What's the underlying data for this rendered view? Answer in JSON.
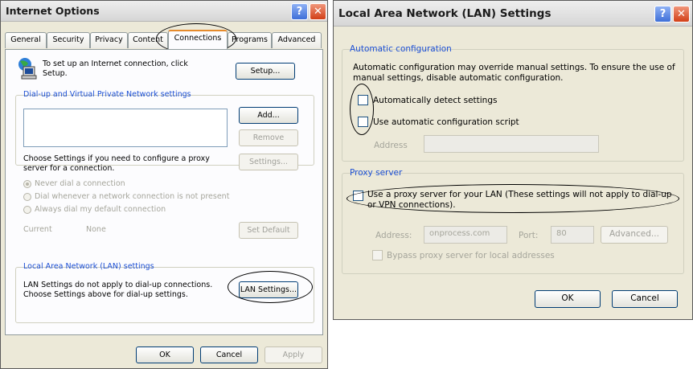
{
  "internet_options": {
    "title": "Internet Options",
    "help_glyph": "?",
    "close_glyph": "✕",
    "tabs": [
      {
        "label": "General"
      },
      {
        "label": "Security"
      },
      {
        "label": "Privacy"
      },
      {
        "label": "Content"
      },
      {
        "label": "Connections"
      },
      {
        "label": "Programs"
      },
      {
        "label": "Advanced"
      }
    ],
    "active_tab": "Connections",
    "setup_text": "To set up an Internet connection, click Setup.",
    "setup_button": "Setup...",
    "dialup_group": "Dial-up and Virtual Private Network settings",
    "add_button": "Add...",
    "remove_button": "Remove",
    "settings_text": "Choose Settings if you need to configure a proxy server for a connection.",
    "settings_button": "Settings...",
    "radio_options": [
      {
        "label": "Never dial a connection",
        "selected": true
      },
      {
        "label": "Dial whenever a network connection is not present",
        "selected": false
      },
      {
        "label": "Always dial my default connection",
        "selected": false
      }
    ],
    "current_label": "Current",
    "current_value": "None",
    "set_default_button": "Set Default",
    "lan_group": "Local Area Network (LAN) settings",
    "lan_text": "LAN Settings do not apply to dial-up connections. Choose Settings above for dial-up settings.",
    "lan_settings_button": "LAN Settings...",
    "ok_button": "OK",
    "cancel_button": "Cancel",
    "apply_button": "Apply"
  },
  "lan_settings": {
    "title": "Local Area Network (LAN) Settings",
    "help_glyph": "?",
    "close_glyph": "✕",
    "auto_group": "Automatic configuration",
    "auto_text": "Automatic configuration may override manual settings. To ensure the use of manual settings, disable automatic configuration.",
    "auto_detect_label": "Automatically detect settings",
    "auto_detect_checked": false,
    "auto_script_label": "Use automatic configuration script",
    "auto_script_checked": false,
    "address_label": "Address",
    "address_value": "",
    "proxy_group": "Proxy server",
    "proxy_label": "Use a proxy server for your LAN (These settings will not apply to dial-up or VPN connections).",
    "proxy_checked": false,
    "proxy_address_label": "Address:",
    "proxy_address_value": "onprocess.com",
    "port_label": "Port:",
    "port_value": "80",
    "advanced_button": "Advanced...",
    "bypass_label": "Bypass proxy server for local addresses",
    "bypass_checked": false,
    "ok_button": "OK",
    "cancel_button": "Cancel"
  },
  "colors": {
    "group_label": "#1c4fd4",
    "dialog_bg": "#ece9d8",
    "active_tab_accent": "#e68b2c"
  },
  "icons": [
    "network-computer-icon",
    "help-icon",
    "close-icon"
  ]
}
